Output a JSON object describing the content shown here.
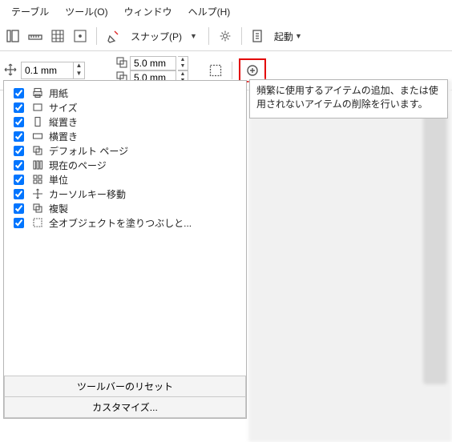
{
  "menu": {
    "table": "テーブル",
    "tool": "ツール(O)",
    "window": "ウィンドウ",
    "help": "ヘルプ(H)"
  },
  "toolbar": {
    "snap_label": "スナップ(P)",
    "launch_label": "起動"
  },
  "subbar": {
    "nudge_value": "0.1 mm",
    "mm_a": "5.0 mm",
    "mm_b": "5.0 mm"
  },
  "tooltip": {
    "text": "頻繁に使用するアイテムの追加、または使用されないアイテムの削除を行います。"
  },
  "items": [
    {
      "label": "用紙",
      "icon": "printer"
    },
    {
      "label": "サイズ",
      "icon": "rect"
    },
    {
      "label": "縦置き",
      "icon": "portrait"
    },
    {
      "label": "横置き",
      "icon": "landscape"
    },
    {
      "label": "デフォルト ページ",
      "icon": "overlap"
    },
    {
      "label": "現在のページ",
      "icon": "bars"
    },
    {
      "label": "単位",
      "icon": "grid4"
    },
    {
      "label": "カーソルキー移動",
      "icon": "nudge"
    },
    {
      "label": "複製",
      "icon": "dup"
    },
    {
      "label": "全オブジェクトを塗りつぶしと...",
      "icon": "dashed-rect"
    }
  ],
  "footer": {
    "reset": "ツールバーのリセット",
    "customize": "カスタマイズ..."
  }
}
